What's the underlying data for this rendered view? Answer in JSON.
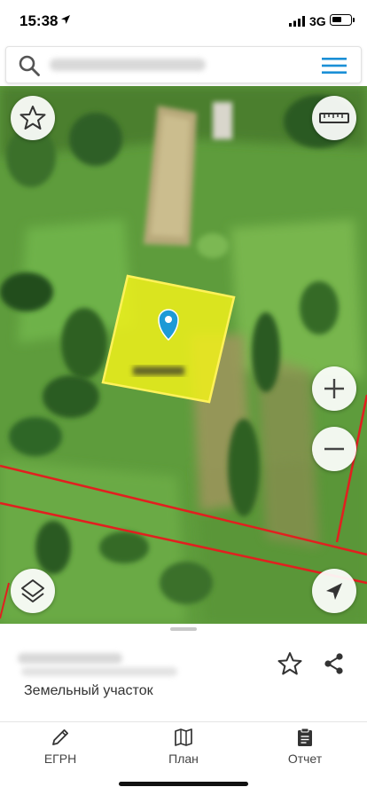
{
  "status": {
    "time": "15:38",
    "carrier": "3G",
    "icons": [
      "location-arrow-icon",
      "signal-icon",
      "battery-icon"
    ]
  },
  "search": {
    "placeholder": "",
    "icons": [
      "search-icon",
      "menu-icon"
    ]
  },
  "map": {
    "buttons": [
      "favorite-star-button",
      "ruler-button",
      "zoom-in-button",
      "zoom-out-button",
      "layers-button",
      "my-location-button"
    ],
    "parcel_fill_color": "#f2f21a",
    "parcel_stroke_color": "#fff25a",
    "boundary_color": "#e21f1f",
    "marker_color": "#1d9ad6"
  },
  "sheet": {
    "parcel_type": "Земельный участок",
    "icons": [
      "star-outline-icon",
      "share-icon"
    ]
  },
  "tabs": [
    {
      "label": "ЕГРН",
      "icon": "pencil-icon"
    },
    {
      "label": "План",
      "icon": "map-icon"
    },
    {
      "label": "Отчет",
      "icon": "clipboard-icon"
    }
  ],
  "colors": {
    "accent": "#1a8fd6"
  }
}
